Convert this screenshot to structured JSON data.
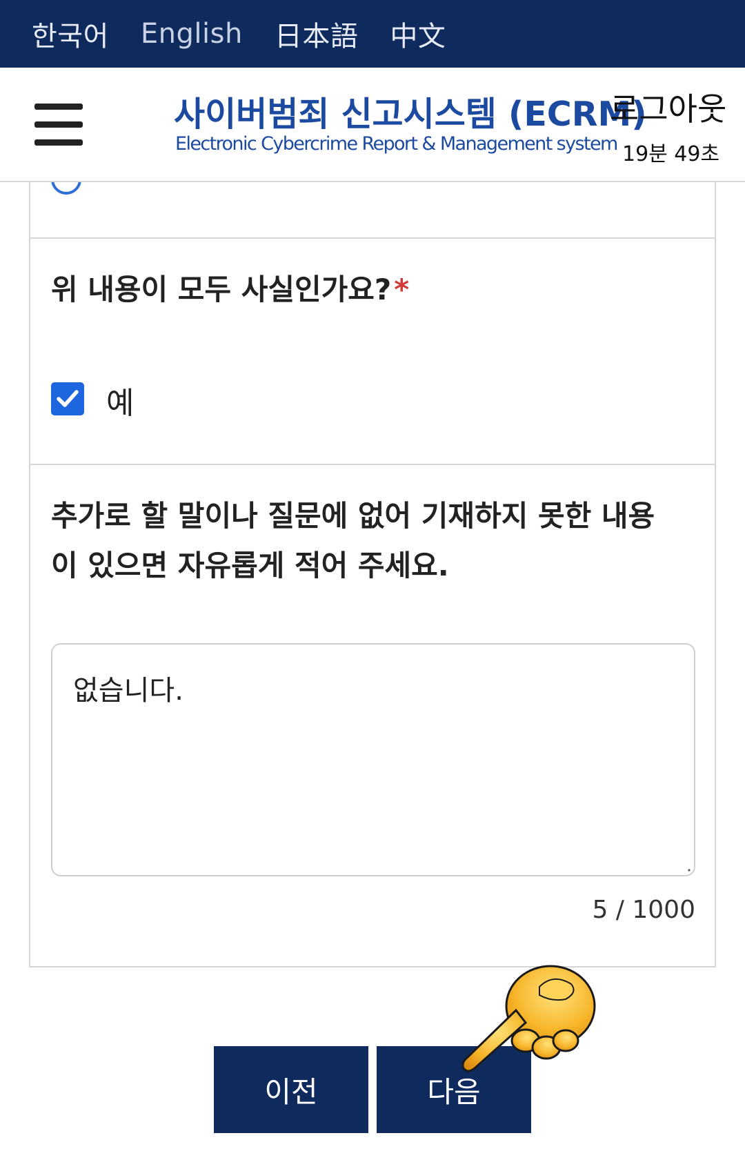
{
  "languages": [
    "한국어",
    "English",
    "日本語",
    "中文"
  ],
  "header": {
    "title": "사이버범죄 신고시스템 (ECRM)",
    "subtitle": "Electronic Cybercrime Report & Management system",
    "logout_label": "로그아웃",
    "session_timer": "19분 49초"
  },
  "form": {
    "question_truth": "위 내용이 모두 사실인가요?",
    "required_mark": "*",
    "truth_option_label": "예",
    "truth_checked": true,
    "question_additional": "추가로 할 말이나 질문에 없어 기재하지 못한 내용이 있으면 자유롭게 적어 주세요.",
    "additional_value": "없습니다.",
    "char_counter": "5 / 1000"
  },
  "buttons": {
    "prev_label": "이전",
    "next_label": "다음"
  },
  "colors": {
    "navy": "#0f2a5c",
    "brand_blue": "#1b4aa0",
    "checkbox_blue": "#1e66e0",
    "required_red": "#d23a3a"
  },
  "icons": {
    "menu": "hamburger-menu-icon",
    "checkbox": "check-icon",
    "pointer": "pointing-hand-icon"
  }
}
